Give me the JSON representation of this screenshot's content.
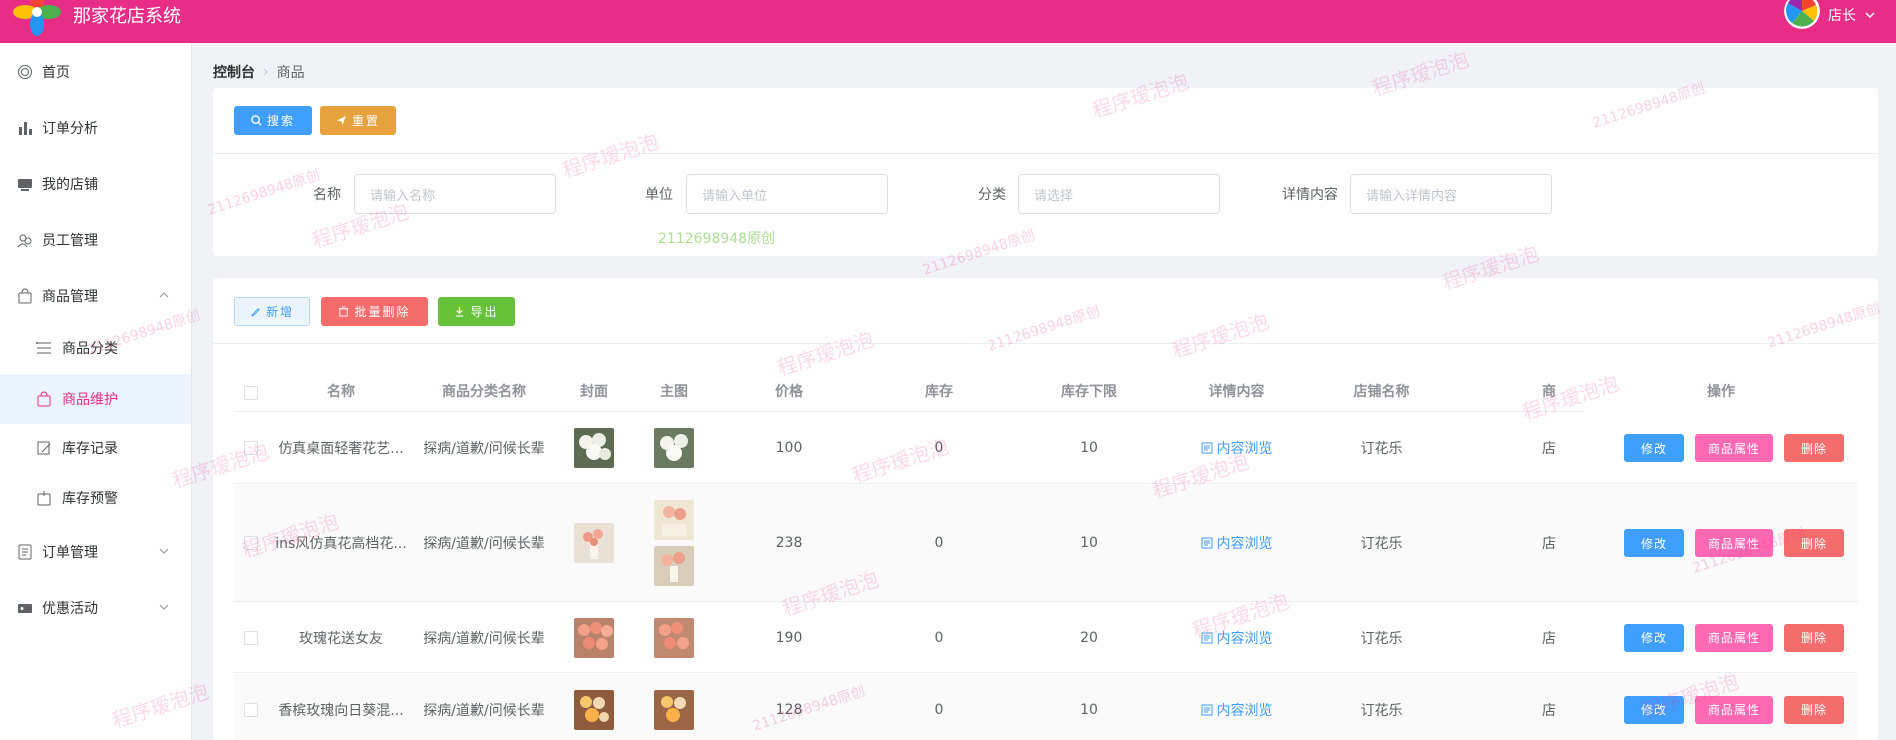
{
  "header": {
    "app_title": "那家花店系统",
    "user_name": "店长"
  },
  "sidebar": {
    "items": [
      {
        "label": "首页",
        "icon": "home-icon"
      },
      {
        "label": "订单分析",
        "icon": "bar-chart-icon"
      },
      {
        "label": "我的店铺",
        "icon": "shop-icon"
      },
      {
        "label": "员工管理",
        "icon": "users-icon"
      },
      {
        "label": "商品管理",
        "icon": "bag-icon"
      },
      {
        "label": "商品分类",
        "icon": "list-icon"
      },
      {
        "label": "商品维护",
        "icon": "bag-icon"
      },
      {
        "label": "库存记录",
        "icon": "edit-icon"
      },
      {
        "label": "库存预警",
        "icon": "alert-icon"
      },
      {
        "label": "订单管理",
        "icon": "document-icon"
      },
      {
        "label": "优惠活动",
        "icon": "coupon-icon"
      }
    ]
  },
  "breadcrumb": {
    "home": "控制台",
    "current": "商品"
  },
  "search": {
    "search_label": "搜索",
    "reset_label": "重置",
    "fields": [
      {
        "label": "名称",
        "placeholder": "请输入名称"
      },
      {
        "label": "单位",
        "placeholder": "请输入单位"
      },
      {
        "label": "分类",
        "placeholder": "请选择"
      },
      {
        "label": "详情内容",
        "placeholder": "请输入详情内容"
      }
    ]
  },
  "toolbar": {
    "add_label": "新增",
    "batch_delete_label": "批量删除",
    "export_label": "导出"
  },
  "table": {
    "columns": [
      "名称",
      "商品分类名称",
      "封面",
      "主图",
      "价格",
      "库存",
      "库存下限",
      "详情内容",
      "店铺名称",
      "商",
      "操作"
    ],
    "rows": [
      {
        "name": "仿真桌面轻奢花艺...",
        "category": "探病/道歉/问候长辈",
        "price": "100",
        "stock": "0",
        "stock_min": "10",
        "detail": "内容浏览",
        "shop": "订花乐",
        "extra": "店"
      },
      {
        "name": "ins风仿真花高档花...",
        "category": "探病/道歉/问候长辈",
        "price": "238",
        "stock": "0",
        "stock_min": "10",
        "detail": "内容浏览",
        "shop": "订花乐",
        "extra": "店"
      },
      {
        "name": "玫瑰花送女友",
        "category": "探病/道歉/问候长辈",
        "price": "190",
        "stock": "0",
        "stock_min": "20",
        "detail": "内容浏览",
        "shop": "订花乐",
        "extra": "店"
      },
      {
        "name": "香槟玫瑰向日葵混...",
        "category": "探病/道歉/问候长辈",
        "price": "128",
        "stock": "0",
        "stock_min": "10",
        "detail": "内容浏览",
        "shop": "订花乐",
        "extra": "店"
      }
    ],
    "actions": {
      "edit": "修改",
      "attr": "商品属性",
      "delete": "删除"
    }
  },
  "watermark": {
    "text": "程序瑷泡泡",
    "code": "2112698948原创"
  },
  "colors": {
    "brand": "#e72d86",
    "primary": "#409eff",
    "warning": "#e6a23c",
    "danger": "#f56c6c",
    "success": "#67c23a",
    "pink": "#ff69b4"
  }
}
